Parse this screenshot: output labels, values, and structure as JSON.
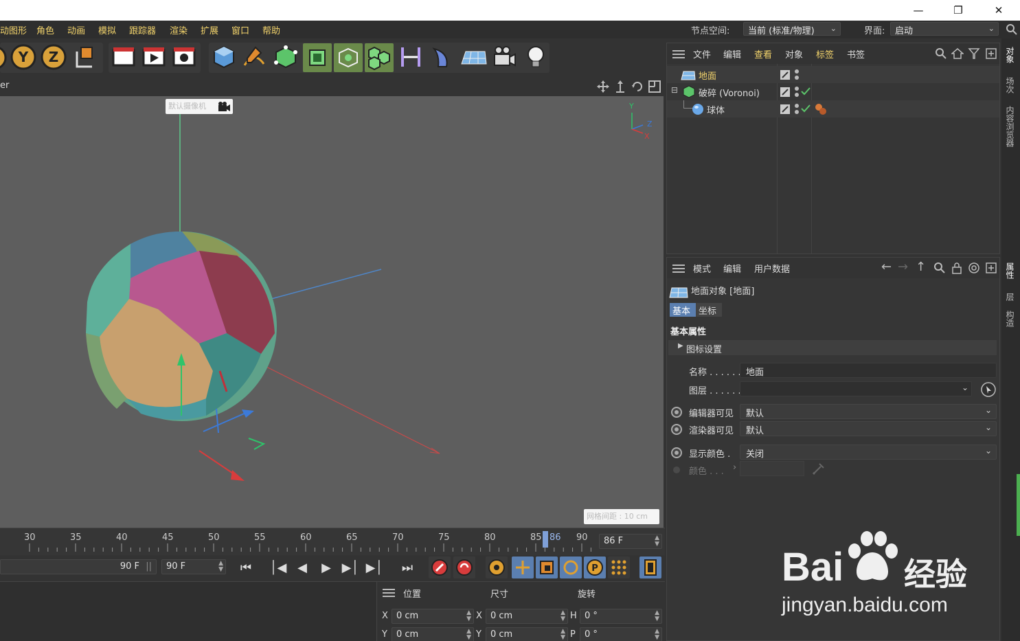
{
  "titlebar": {
    "minimize_icon": "minimize-icon",
    "maximize_icon": "restore-icon",
    "close_icon": "close-icon"
  },
  "menu": {
    "items": [
      "动图形",
      "角色",
      "动画",
      "模拟",
      "跟踪器",
      "渲染",
      "扩展",
      "窗口",
      "帮助"
    ],
    "node_space_label": "节点空间:",
    "node_space_value": "当前 (标准/物理)",
    "layout_label": "界面:",
    "layout_value": "启动"
  },
  "viewport": {
    "header_text": "er",
    "camera_label": "默认摄像机",
    "grid_label": "网格间距 : 10 cm",
    "axis_y": "Y",
    "axis_z": "Z",
    "axis_x": "X"
  },
  "timeline": {
    "ticks": [
      "30",
      "35",
      "40",
      "45",
      "50",
      "55",
      "60",
      "65",
      "70",
      "75",
      "80",
      "85",
      "90"
    ],
    "current_marker": "86",
    "current_frame": "86 F",
    "end_frame_a": "90 F",
    "end_frame_b": "90 F"
  },
  "coords": {
    "header_position": "位置",
    "header_size": "尺寸",
    "header_rotation": "旋转",
    "row1": {
      "a_label": "X",
      "a_value": "0 cm",
      "b_label": "X",
      "b_value": "0 cm",
      "c_label": "H",
      "c_value": "0 °"
    },
    "row2": {
      "a_label": "Y",
      "a_value": "0 cm",
      "b_label": "Y",
      "b_value": "0 cm",
      "c_label": "P",
      "c_value": "0 °"
    }
  },
  "objects": {
    "menu": [
      "文件",
      "编辑",
      "查看",
      "对象",
      "标签",
      "书签"
    ],
    "rows": [
      {
        "name": "地面",
        "selected": true
      },
      {
        "name": "破碎 (Voronoi)",
        "selected": false
      },
      {
        "name": "球体",
        "selected": false
      }
    ]
  },
  "attributes": {
    "menu": [
      "模式",
      "编辑",
      "用户数据"
    ],
    "object_title": "地面对象 [地面]",
    "tab_basic": "基本",
    "tab_coord": "坐标",
    "section_title": "基本属性",
    "subsection": "图标设置",
    "name_label": "名称 . . . . . .",
    "name_value": "地面",
    "layer_label": "图层 . . . . . .",
    "layer_value": "",
    "editor_visible_label": "编辑器可见",
    "editor_visible_value": "默认",
    "render_visible_label": "渲染器可见",
    "render_visible_value": "默认",
    "display_color_label": "显示颜色 .",
    "display_color_value": "关闭",
    "color_label": "颜色 . . ."
  },
  "side_tabs": {
    "top": [
      "对象",
      "场次",
      "内容浏览器"
    ],
    "bottom": [
      "属性",
      "层",
      "构造"
    ]
  },
  "watermark": {
    "brand": "Bai",
    "brand2": "经验",
    "url": "jingyan.baidu.com"
  },
  "colors": {
    "accent_yellow": "#f2d36b",
    "active_green": "#6a8a4a",
    "select_blue": "#5b7fb0"
  }
}
